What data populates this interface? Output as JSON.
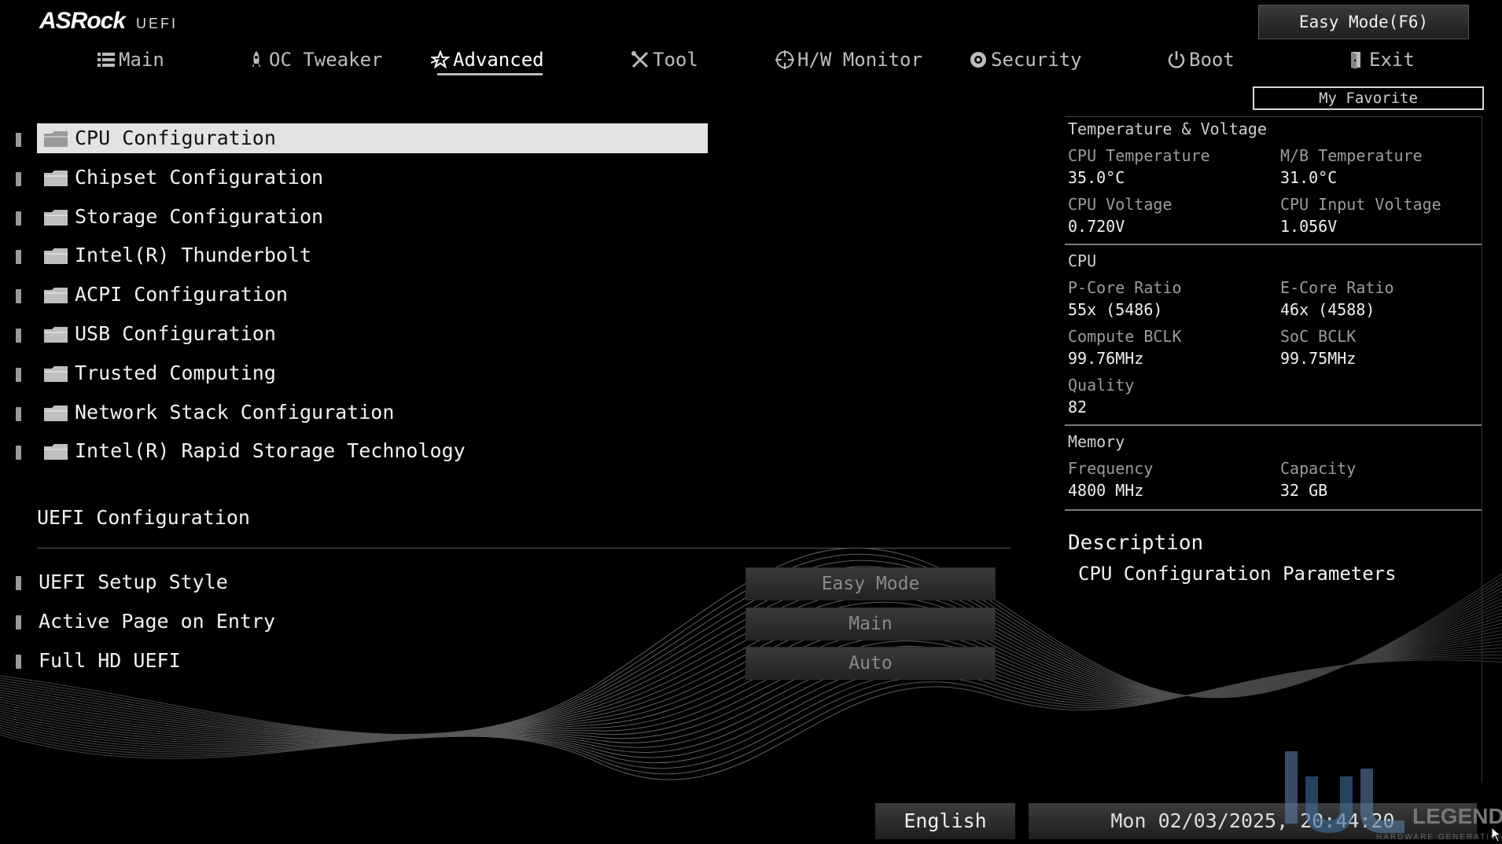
{
  "header": {
    "brand": "ASRock",
    "brand_sub": "UEFI",
    "easy_mode_button": "Easy Mode(F6)",
    "my_favorite_button": "My Favorite"
  },
  "tabs": [
    {
      "label": "Main",
      "icon": "list-icon"
    },
    {
      "label": "OC Tweaker",
      "icon": "rocket-icon"
    },
    {
      "label": "Advanced",
      "icon": "star-icon",
      "active": true
    },
    {
      "label": "Tool",
      "icon": "tools-icon"
    },
    {
      "label": "H/W Monitor",
      "icon": "crosshair-icon"
    },
    {
      "label": "Security",
      "icon": "shield-icon"
    },
    {
      "label": "Boot",
      "icon": "power-icon"
    },
    {
      "label": "Exit",
      "icon": "exit-door-icon"
    }
  ],
  "menu_items": [
    "CPU Configuration",
    "Chipset Configuration",
    "Storage Configuration",
    "Intel(R) Thunderbolt",
    "ACPI Configuration",
    "USB Configuration",
    "Trusted Computing",
    "Network Stack Configuration",
    "Intel(R) Rapid Storage Technology"
  ],
  "uefi_section": {
    "title": "UEFI Configuration",
    "options": [
      {
        "label": "UEFI Setup Style",
        "value": "Easy Mode"
      },
      {
        "label": "Active Page on Entry",
        "value": "Main"
      },
      {
        "label": "Full HD UEFI",
        "value": "Auto"
      }
    ]
  },
  "monitor": {
    "temp_voltage_title": "Temperature & Voltage",
    "cpu_temp_label": "CPU Temperature",
    "cpu_temp_value": "35.0°C",
    "mb_temp_label": "M/B Temperature",
    "mb_temp_value": "31.0°C",
    "cpu_voltage_label": "CPU Voltage",
    "cpu_voltage_value": "0.720V",
    "cpu_input_voltage_label": "CPU Input Voltage",
    "cpu_input_voltage_value": "1.056V",
    "cpu_title": "CPU",
    "pcore_label": "P-Core Ratio",
    "pcore_value": "55x (5486)",
    "ecore_label": "E-Core Ratio",
    "ecore_value": "46x (4588)",
    "compute_bclk_label": "Compute BCLK",
    "compute_bclk_value": "99.76MHz",
    "soc_bclk_label": "SoC BCLK",
    "soc_bclk_value": "99.75MHz",
    "quality_label": "Quality",
    "quality_value": "82",
    "memory_title": "Memory",
    "frequency_label": "Frequency",
    "frequency_value": "4800 MHz",
    "capacity_label": "Capacity",
    "capacity_value": "32 GB"
  },
  "description": {
    "title": "Description",
    "text": "CPU Configuration Parameters"
  },
  "footer": {
    "language": "English",
    "datetime": "Mon 02/03/2025, 20:44:20"
  },
  "watermark": {
    "text": "LEGEND",
    "subtext": "HARDWARE GENERATION"
  }
}
